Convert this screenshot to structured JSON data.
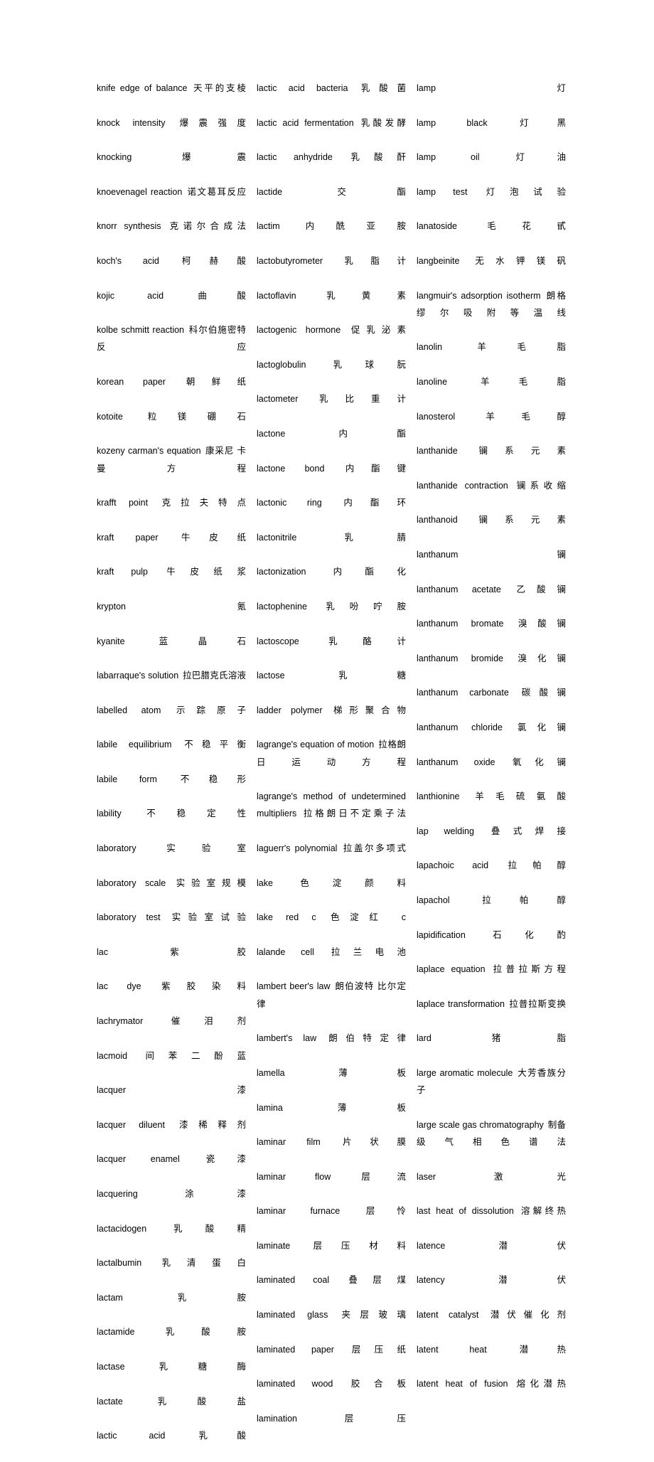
{
  "page": {
    "type": "dictionary-page",
    "language_pair": "english-chinese",
    "background_color": "#ffffff",
    "text_color": "#000000",
    "column_count": 3
  },
  "columns": [
    {
      "name": "column-1",
      "entries": [
        {
          "term": "knife edge of balance",
          "gloss": "天平的支棱"
        },
        {
          "term": "knock intensity",
          "gloss": "爆震强度"
        },
        {
          "term": "knocking",
          "gloss": "爆震"
        },
        {
          "term": "knoevenagel reaction",
          "gloss": "诺文葛耳反应"
        },
        {
          "term": "knorr synthesis",
          "gloss": "克诺尔合成法"
        },
        {
          "term": "koch's acid",
          "gloss": "柯赫酸"
        },
        {
          "term": "kojic acid",
          "gloss": "曲酸"
        },
        {
          "term": "kolbe schmitt reaction",
          "gloss": "科尔伯施密特反应"
        },
        {
          "term": "korean paper",
          "gloss": "朝鲜纸"
        },
        {
          "term": "kotoite",
          "gloss": "粒镁硼石"
        },
        {
          "term": "kozeny carman's equation",
          "gloss": "康采尼 卡曼方程"
        },
        {
          "term": "krafft point",
          "gloss": "克拉夫特点"
        },
        {
          "term": "kraft paper",
          "gloss": "牛皮纸"
        },
        {
          "term": "kraft pulp",
          "gloss": "牛皮纸浆"
        },
        {
          "term": "krypton",
          "gloss": "氪"
        },
        {
          "term": "kyanite",
          "gloss": "蓝晶石"
        },
        {
          "term": "labarraque's solution",
          "gloss": "拉巴腊克氏溶液"
        },
        {
          "term": "labelled atom",
          "gloss": "示踪原子"
        },
        {
          "term": "labile equilibrium",
          "gloss": "不稳平衡"
        },
        {
          "term": "labile form",
          "gloss": "不稳形"
        },
        {
          "term": "lability",
          "gloss": "不稳定性"
        },
        {
          "term": "laboratory",
          "gloss": "实验室"
        },
        {
          "term": "laboratory scale",
          "gloss": "实验室规模"
        },
        {
          "term": "laboratory test",
          "gloss": "实验室试验"
        },
        {
          "term": "lac",
          "gloss": "紫胶"
        },
        {
          "term": "lac dye",
          "gloss": "紫胶染料"
        },
        {
          "term": "lachrymator",
          "gloss": "催泪剂"
        },
        {
          "term": "lacmoid",
          "gloss": "间苯二酚蓝"
        },
        {
          "term": "lacquer",
          "gloss": "漆"
        },
        {
          "term": "lacquer diluent",
          "gloss": "漆稀释剂"
        },
        {
          "term": "lacquer enamel",
          "gloss": "瓷漆"
        },
        {
          "term": "lacquering",
          "gloss": "涂漆"
        },
        {
          "term": "lactacidogen",
          "gloss": "乳酸精"
        },
        {
          "term": "lactalbumin",
          "gloss": "乳清蛋白"
        },
        {
          "term": "lactam",
          "gloss": "乳胺"
        },
        {
          "term": "lactamide",
          "gloss": "乳酸胺"
        },
        {
          "term": "lactase",
          "gloss": "乳糖酶"
        },
        {
          "term": "lactate",
          "gloss": "乳酸盐"
        },
        {
          "term": "lactic acid",
          "gloss": "乳酸"
        }
      ]
    },
    {
      "name": "column-2",
      "entries": [
        {
          "term": "lactic acid bacteria",
          "gloss": "乳酸菌"
        },
        {
          "term": "lactic acid fermentation",
          "gloss": "乳酸发酵"
        },
        {
          "term": "lactic anhydride",
          "gloss": "乳酸酐"
        },
        {
          "term": "lactide",
          "gloss": "交酯"
        },
        {
          "term": "lactim",
          "gloss": "内酰亚胺"
        },
        {
          "term": "lactobutyrometer",
          "gloss": "乳脂计"
        },
        {
          "term": "lactoflavin",
          "gloss": "乳黄素"
        },
        {
          "term": "lactogenic hormone",
          "gloss": "促乳泌素"
        },
        {
          "term": "lactoglobulin",
          "gloss": "乳球朊"
        },
        {
          "term": "lactometer",
          "gloss": "乳比重计"
        },
        {
          "term": "lactone",
          "gloss": "内酯"
        },
        {
          "term": "lactone bond",
          "gloss": "内酯键"
        },
        {
          "term": "lactonic ring",
          "gloss": "内酯环"
        },
        {
          "term": "lactonitrile",
          "gloss": "乳腈"
        },
        {
          "term": "lactonization",
          "gloss": "内酯化"
        },
        {
          "term": "lactophenine",
          "gloss": "乳吩咛胺"
        },
        {
          "term": "lactoscope",
          "gloss": "乳酪计"
        },
        {
          "term": "lactose",
          "gloss": "乳糖"
        },
        {
          "term": "ladder polymer",
          "gloss": "梯形聚合物"
        },
        {
          "term": "lagrange's equation of motion",
          "gloss": "拉格朗日运动方程"
        },
        {
          "term": "lagrange's method of undetermined multipliers",
          "gloss": "拉格朗日不定乘子法"
        },
        {
          "term": "laguerr's polynomial",
          "gloss": "拉盖尔多项式"
        },
        {
          "term": "lake",
          "gloss": "色淀颜料"
        },
        {
          "term": "lake red c",
          "gloss": "色淀红 c"
        },
        {
          "term": "lalande cell",
          "gloss": "拉兰电池"
        },
        {
          "term": "lambert beer's law",
          "gloss": "朗伯波特 比尔定律"
        },
        {
          "term": "lambert's law",
          "gloss": "朗伯特定律"
        },
        {
          "term": "lamella",
          "gloss": "薄板"
        },
        {
          "term": "lamina",
          "gloss": "薄板"
        },
        {
          "term": "laminar film",
          "gloss": "片状膜"
        },
        {
          "term": "laminar flow",
          "gloss": "层流"
        },
        {
          "term": "laminar furnace",
          "gloss": "层怜"
        },
        {
          "term": "laminate",
          "gloss": "层压材料"
        },
        {
          "term": "laminated coal",
          "gloss": "叠层煤"
        },
        {
          "term": "laminated glass",
          "gloss": "夹层玻璃"
        },
        {
          "term": "laminated paper",
          "gloss": "层压纸"
        },
        {
          "term": "laminated wood",
          "gloss": "胶合板"
        },
        {
          "term": "lamination",
          "gloss": "层压"
        }
      ]
    },
    {
      "name": "column-3",
      "entries": [
        {
          "term": "lamp",
          "gloss": "灯"
        },
        {
          "term": "lamp black",
          "gloss": "灯黑"
        },
        {
          "term": "lamp oil",
          "gloss": "灯油"
        },
        {
          "term": "lamp test",
          "gloss": "灯泡试验"
        },
        {
          "term": "lanatoside",
          "gloss": "毛花甙"
        },
        {
          "term": "langbeinite",
          "gloss": "无水钾镁矾"
        },
        {
          "term": "langmuir's adsorption isotherm",
          "gloss": "朗格缪尔吸附等温线"
        },
        {
          "term": "lanolin",
          "gloss": "羊毛脂"
        },
        {
          "term": "lanoline",
          "gloss": "羊毛脂"
        },
        {
          "term": "lanosterol",
          "gloss": "羊毛醇"
        },
        {
          "term": "lanthanide",
          "gloss": "镧系元素"
        },
        {
          "term": "lanthanide contraction",
          "gloss": "镧系收缩"
        },
        {
          "term": "lanthanoid",
          "gloss": "镧系元素"
        },
        {
          "term": "lanthanum",
          "gloss": "镧"
        },
        {
          "term": "lanthanum acetate",
          "gloss": "乙酸镧"
        },
        {
          "term": "lanthanum bromate",
          "gloss": "溴酸镧"
        },
        {
          "term": "lanthanum bromide",
          "gloss": "溴化镧"
        },
        {
          "term": "lanthanum carbonate",
          "gloss": "碳酸镧"
        },
        {
          "term": "lanthanum chloride",
          "gloss": "氯化镧"
        },
        {
          "term": "lanthanum oxide",
          "gloss": "氧化镧"
        },
        {
          "term": "lanthionine",
          "gloss": "羊毛硫氨酸"
        },
        {
          "term": "lap welding",
          "gloss": "叠式焊接"
        },
        {
          "term": "lapachoic acid",
          "gloss": "拉帕醇"
        },
        {
          "term": "lapachol",
          "gloss": "拉帕醇"
        },
        {
          "term": "lapidification",
          "gloss": "石化酌"
        },
        {
          "term": "laplace equation",
          "gloss": "拉普拉斯方程"
        },
        {
          "term": "laplace transformation",
          "gloss": "拉普拉斯变换"
        },
        {
          "term": "lard",
          "gloss": "猪脂"
        },
        {
          "term": "large aromatic molecule",
          "gloss": "大芳香族分子"
        },
        {
          "term": "large scale gas chromatography",
          "gloss": "制备级气相色谱法"
        },
        {
          "term": "laser",
          "gloss": "激光"
        },
        {
          "term": "last heat of dissolution",
          "gloss": "溶解终热"
        },
        {
          "term": "latence",
          "gloss": "潜伏"
        },
        {
          "term": "latency",
          "gloss": "潜伏"
        },
        {
          "term": "latent catalyst",
          "gloss": "潜伏催化剂"
        },
        {
          "term": "latent heat",
          "gloss": "潜热"
        },
        {
          "term": "latent heat of fusion",
          "gloss": "熔化潜热"
        }
      ]
    }
  ]
}
